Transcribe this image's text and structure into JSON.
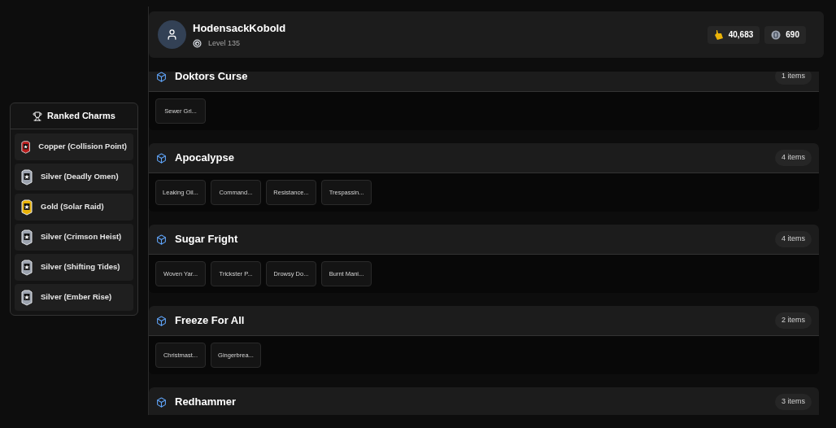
{
  "sidebar": {
    "title": "Ranked Charms",
    "charms": [
      {
        "label": "Copper (Collision Point)",
        "color": "#b91c1c"
      },
      {
        "label": "Silver (Deadly Omen)",
        "color": "#9ca3af"
      },
      {
        "label": "Gold (Solar Raid)",
        "color": "#eab308"
      },
      {
        "label": "Silver (Crimson Heist)",
        "color": "#9ca3af"
      },
      {
        "label": "Silver (Shifting Tides)",
        "color": "#9ca3af"
      },
      {
        "label": "Silver (Ember Rise)",
        "color": "#9ca3af"
      }
    ]
  },
  "profile": {
    "name": "HodensackKobold",
    "level": "Level 135",
    "currencies": [
      {
        "kind": "renown",
        "value": "40,683"
      },
      {
        "kind": "credits",
        "value": "690"
      }
    ]
  },
  "collections": [
    {
      "title": "Doktors Curse",
      "count": "1 items",
      "items": [
        "Sewer Gri..."
      ]
    },
    {
      "title": "Apocalypse",
      "count": "4 items",
      "items": [
        "Leaking Oil...",
        "Command...",
        "Resistance...",
        "Trespassin..."
      ]
    },
    {
      "title": "Sugar Fright",
      "count": "4 items",
      "items": [
        "Woven Yar...",
        "Trickster P...",
        "Drowsy Do...",
        "Burnt Mani..."
      ]
    },
    {
      "title": "Freeze For All",
      "count": "2 items",
      "items": [
        "Christmast...",
        "Gingerbrea..."
      ]
    },
    {
      "title": "Redhammer",
      "count": "3 items"
    }
  ]
}
